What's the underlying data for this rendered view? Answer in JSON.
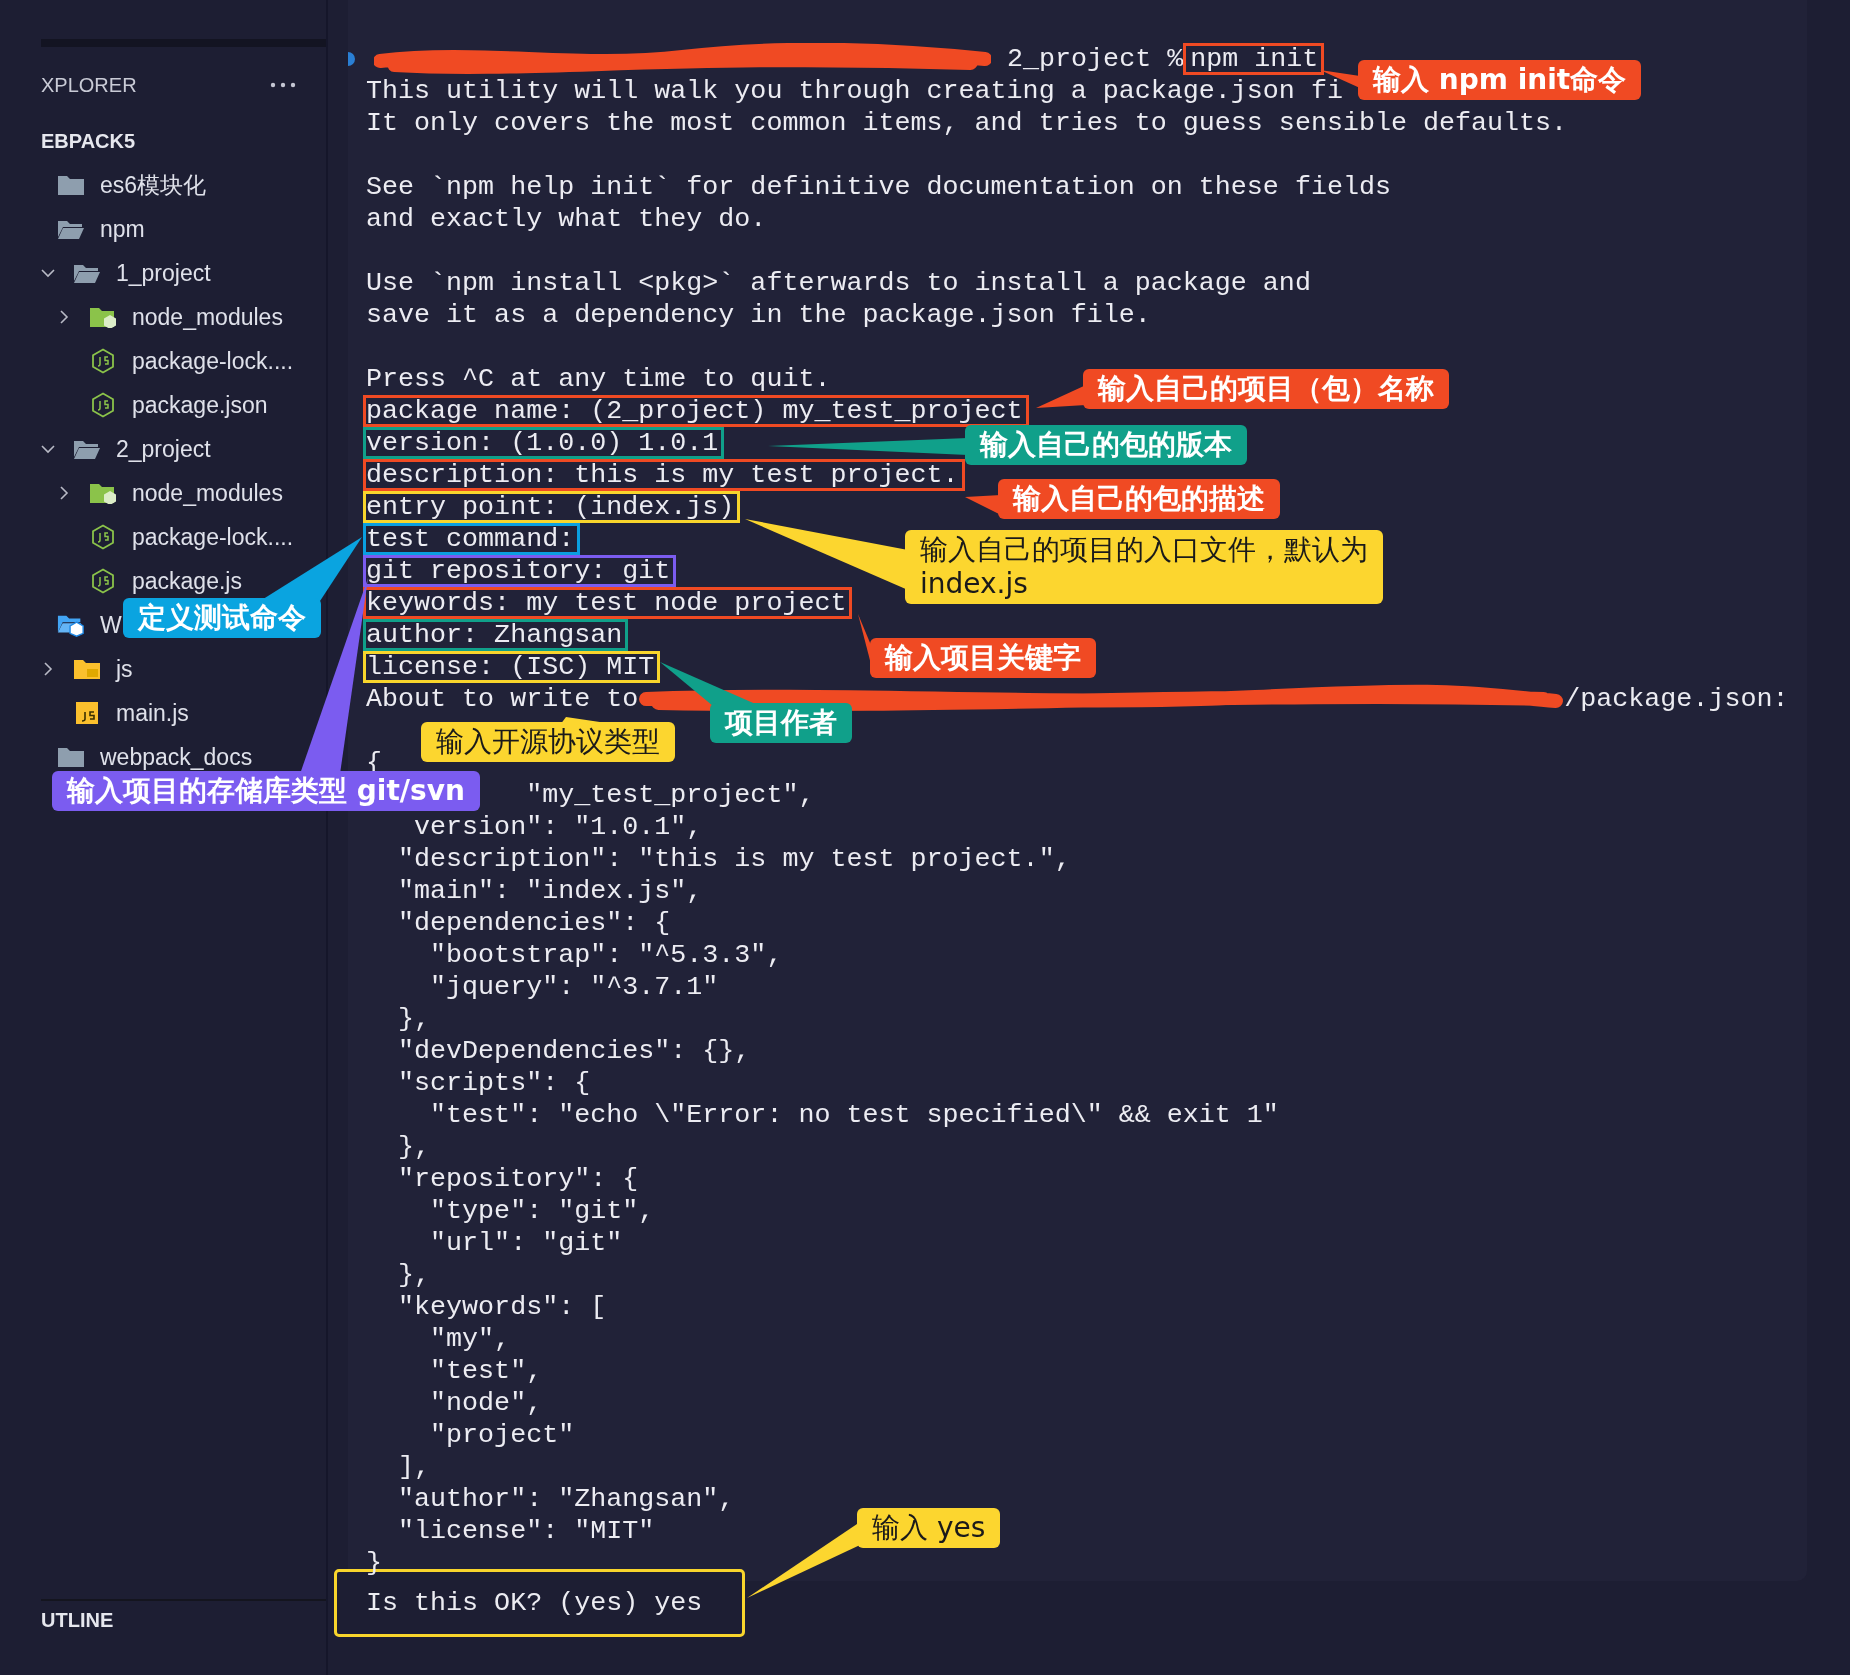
{
  "sidebar": {
    "title": "XPLORER",
    "section": "EBPACK5",
    "tree": [
      {
        "label": "es6模块化",
        "kind": "folder",
        "expanded": false
      },
      {
        "label": "npm",
        "kind": "folder",
        "expanded": true,
        "children": [
          {
            "label": "1_project",
            "kind": "folder",
            "expanded": true,
            "children": [
              {
                "label": "node_modules",
                "kind": "node-folder",
                "expanded": false
              },
              {
                "label": "package-lock....",
                "kind": "nodejs-file"
              },
              {
                "label": "package.json",
                "kind": "nodejs-file"
              }
            ]
          },
          {
            "label": "2_project",
            "kind": "folder",
            "expanded": true,
            "children": [
              {
                "label": "node_modules",
                "kind": "node-folder",
                "expanded": false
              },
              {
                "label": "package-lock....",
                "kind": "nodejs-file"
              },
              {
                "label": "package.js",
                "kind": "nodejs-file"
              }
            ]
          }
        ]
      },
      {
        "label": "W",
        "kind": "special-folder",
        "expanded": true,
        "children": [
          {
            "label": "js",
            "kind": "js-folder",
            "expanded": false
          },
          {
            "label": "main.js",
            "kind": "js-file"
          }
        ]
      },
      {
        "label": "webpack_docs",
        "kind": "folder",
        "expanded": false
      }
    ],
    "outline": "UTLINE"
  },
  "terminal": {
    "prompt": {
      "text": "2_project %",
      "command": "npm init",
      "color": "#f04a23"
    },
    "lines": [
      {
        "kind": "text",
        "text": "This utility will walk you through creating a package.json fi"
      },
      {
        "kind": "text",
        "text": "It only covers the most common items, and tries to guess sensible defaults."
      },
      {
        "kind": "blank"
      },
      {
        "kind": "text",
        "text": "See `npm help init` for definitive documentation on these fields"
      },
      {
        "kind": "text",
        "text": "and exactly what they do."
      },
      {
        "kind": "blank"
      },
      {
        "kind": "text",
        "text": "Use `npm install <pkg>` afterwards to install a package and"
      },
      {
        "kind": "text",
        "text": "save it as a dependency in the package.json file."
      },
      {
        "kind": "blank"
      },
      {
        "kind": "text",
        "text": "Press ^C at any time to quit."
      },
      {
        "kind": "answer",
        "text": "package name: (2_project) my_test_project",
        "color": "#f04a23"
      },
      {
        "kind": "answer",
        "text": "version: (1.0.0) 1.0.1",
        "color": "#10a08a"
      },
      {
        "kind": "answer",
        "text": "description: this is my test project.",
        "color": "#f04a23"
      },
      {
        "kind": "answer",
        "text": "entry point: (index.js)",
        "color": "#f8d52c"
      },
      {
        "kind": "answer",
        "text": "test command:",
        "color": "#0a9fe0"
      },
      {
        "kind": "answer",
        "text": "git repository: git",
        "color": "#7b5cf0"
      },
      {
        "kind": "answer",
        "text": "keywords: my test node project",
        "color": "#f04a23"
      },
      {
        "kind": "answer",
        "text": "author: Zhangsan",
        "color": "#10a08a"
      },
      {
        "kind": "answer",
        "text": "license: (ISC) MIT",
        "color": "#f8d52c"
      },
      {
        "kind": "redacted",
        "text": "About to write to",
        "suffix": "/package.json:"
      },
      {
        "kind": "blank"
      },
      {
        "kind": "text",
        "text": "{"
      },
      {
        "kind": "text",
        "text": "          \"my_test_project\","
      },
      {
        "kind": "text",
        "text": "   version\": \"1.0.1\","
      },
      {
        "kind": "text",
        "text": "  \"description\": \"this is my test project.\","
      },
      {
        "kind": "text",
        "text": "  \"main\": \"index.js\","
      },
      {
        "kind": "text",
        "text": "  \"dependencies\": {"
      },
      {
        "kind": "text",
        "text": "    \"bootstrap\": \"^5.3.3\","
      },
      {
        "kind": "text",
        "text": "    \"jquery\": \"^3.7.1\""
      },
      {
        "kind": "text",
        "text": "  },"
      },
      {
        "kind": "text",
        "text": "  \"devDependencies\": {},"
      },
      {
        "kind": "text",
        "text": "  \"scripts\": {"
      },
      {
        "kind": "text",
        "text": "    \"test\": \"echo \\\"Error: no test specified\\\" && exit 1\""
      },
      {
        "kind": "text",
        "text": "  },"
      },
      {
        "kind": "text",
        "text": "  \"repository\": {"
      },
      {
        "kind": "text",
        "text": "    \"type\": \"git\","
      },
      {
        "kind": "text",
        "text": "    \"url\": \"git\""
      },
      {
        "kind": "text",
        "text": "  },"
      },
      {
        "kind": "text",
        "text": "  \"keywords\": ["
      },
      {
        "kind": "text",
        "text": "    \"my\","
      },
      {
        "kind": "text",
        "text": "    \"test\","
      },
      {
        "kind": "text",
        "text": "    \"node\","
      },
      {
        "kind": "text",
        "text": "    \"project\""
      },
      {
        "kind": "text",
        "text": "  ],"
      },
      {
        "kind": "text",
        "text": "  \"author\": \"Zhangsan\","
      },
      {
        "kind": "text",
        "text": "  \"license\": \"MIT\""
      },
      {
        "kind": "text",
        "text": "}"
      }
    ],
    "confirm": {
      "text": "Is this OK? (yes) yes",
      "color": "#f8d52c"
    }
  },
  "callouts": [
    {
      "text": "输入 npm init命令",
      "color": "#f04a23"
    },
    {
      "text": "输入自己的项目（包）名称",
      "color": "#f04a23"
    },
    {
      "text": "输入自己的包的版本",
      "color": "#10a08a"
    },
    {
      "text": "输入自己的包的描述",
      "color": "#f04a23"
    },
    {
      "text": "输入自己的项目的入口文件，默认为\nindex.js",
      "color": "#fcd62f"
    },
    {
      "text": "定义测试命令",
      "color": "#0aa4e0"
    },
    {
      "text": "输入项目关键字",
      "color": "#f04a23"
    },
    {
      "text": "项目作者",
      "color": "#10a08a"
    },
    {
      "text": "输入开源协议类型",
      "color": "#fcd62f"
    },
    {
      "text": "输入项目的存储库类型 git/svn",
      "color": "#7b5cf0"
    },
    {
      "text": "输入 yes",
      "color": "#fcd62f"
    }
  ]
}
